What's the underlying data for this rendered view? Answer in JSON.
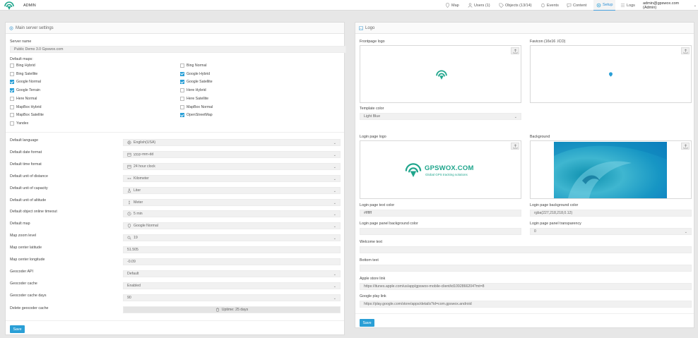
{
  "header": {
    "admin_label": "ADMIN",
    "nav": [
      {
        "label": "Map",
        "icon": "map-marker-icon"
      },
      {
        "label": "Users (1)",
        "icon": "user-icon"
      },
      {
        "label": "Objects (13/14)",
        "icon": "tag-icon"
      },
      {
        "label": "Events",
        "icon": "bell-icon"
      },
      {
        "label": "Content",
        "icon": "chat-icon"
      },
      {
        "label": "Setup",
        "icon": "gear-icon"
      },
      {
        "label": "Logs",
        "icon": "list-icon"
      }
    ],
    "user": "admin@gpswox.com (Admin)",
    "active_tab": "Setup"
  },
  "main": {
    "title": "Main server settings",
    "server_name_label": "Server name",
    "server_name": "Public Demo 3.0 Gpswox.com",
    "default_maps_label": "Default maps:",
    "maps": [
      {
        "label": "Bing Hybrid",
        "checked": false
      },
      {
        "label": "Bing Normal",
        "checked": false
      },
      {
        "label": "Bing Satellite",
        "checked": false
      },
      {
        "label": "Google Hybrid",
        "checked": true
      },
      {
        "label": "Google Normal",
        "checked": true
      },
      {
        "label": "Google Satellite",
        "checked": true
      },
      {
        "label": "Google Terrain",
        "checked": true
      },
      {
        "label": "Here Hybrid",
        "checked": false
      },
      {
        "label": "Here Normal",
        "checked": false
      },
      {
        "label": "Here Satellite",
        "checked": false
      },
      {
        "label": "MapBox Hybrid",
        "checked": false
      },
      {
        "label": "MapBox Normal",
        "checked": false
      },
      {
        "label": "MapBox Satellite",
        "checked": false
      },
      {
        "label": "OpenStreetMap",
        "checked": true
      },
      {
        "label": "Yandex",
        "checked": false
      }
    ],
    "settings": [
      {
        "label": "Default language",
        "value": "English(USA)",
        "icon": "globe-icon",
        "select": true
      },
      {
        "label": "Default date format",
        "value": "yyyy-mm-dd",
        "icon": "calendar-icon",
        "select": true
      },
      {
        "label": "Default time format",
        "value": "24 hour clock",
        "icon": "calendar-icon",
        "select": true
      },
      {
        "label": "Default unit of distance",
        "value": "Kilometer",
        "icon": "arrows-h-icon",
        "select": true
      },
      {
        "label": "Default unit of capacity",
        "value": "Liter",
        "icon": "flask-icon",
        "select": true
      },
      {
        "label": "Default unit of altitude",
        "value": "Meter",
        "icon": "arrows-v-icon",
        "select": true
      },
      {
        "label": "Default object online timeout",
        "value": "5 min",
        "icon": "clock-icon",
        "select": true
      },
      {
        "label": "Default map",
        "value": "Google Normal",
        "icon": "map-marker-icon",
        "select": true
      },
      {
        "label": "Map zoom level",
        "value": "19",
        "icon": "search-icon",
        "select": true
      },
      {
        "label": "Map center latitude",
        "value": "51.505",
        "icon": "",
        "select": false
      },
      {
        "label": "Map center longitude",
        "value": "-0.09",
        "icon": "",
        "select": false
      },
      {
        "label": "Geocoder API",
        "value": "Default",
        "icon": "",
        "select": true
      },
      {
        "label": "Geocoder cache",
        "value": "Enabled",
        "icon": "",
        "select": true
      },
      {
        "label": "Geocoder cache days",
        "value": "90",
        "icon": "",
        "select": true
      }
    ],
    "delete_cache_label": "Delete geocoder cache",
    "delete_cache_btn": "Uptime: 25 days",
    "save": "Save"
  },
  "logo": {
    "title": "Logo",
    "frontpage_label": "Frontpage logo",
    "favicon_label": "Favicon (16x16 .ICO)",
    "template_color_label": "Template color",
    "template_color": "Light Blue",
    "login_logo_label": "Login page logo",
    "background_label": "Background",
    "brand_name": "GPSWOX.COM",
    "brand_tagline": "Global GPS tracking solutions",
    "login_text_color_label": "Login page text color",
    "login_text_color": "#ffffff",
    "login_bg_color_label": "Login page background color",
    "login_bg_color": "rgba(227,218,218,0.12)",
    "panel_bg_label": "Login page panel background color",
    "panel_bg": "",
    "panel_transparency_label": "Login page panel transparency",
    "panel_transparency": "0",
    "welcome_label": "Welcome text",
    "welcome": "",
    "bottom_label": "Bottom text",
    "bottom": "",
    "apple_label": "Apple store link",
    "apple": "https://itunes.apple.com/us/app/gpswox-mobile-client/id1092866204?mt=8",
    "google_label": "Google play link",
    "google": "https://play.google.com/store/apps/details?id=com.gpswox.android",
    "save": "Save"
  },
  "colors": {
    "accent": "#2a9fd6",
    "teal": "#1fa58c"
  }
}
